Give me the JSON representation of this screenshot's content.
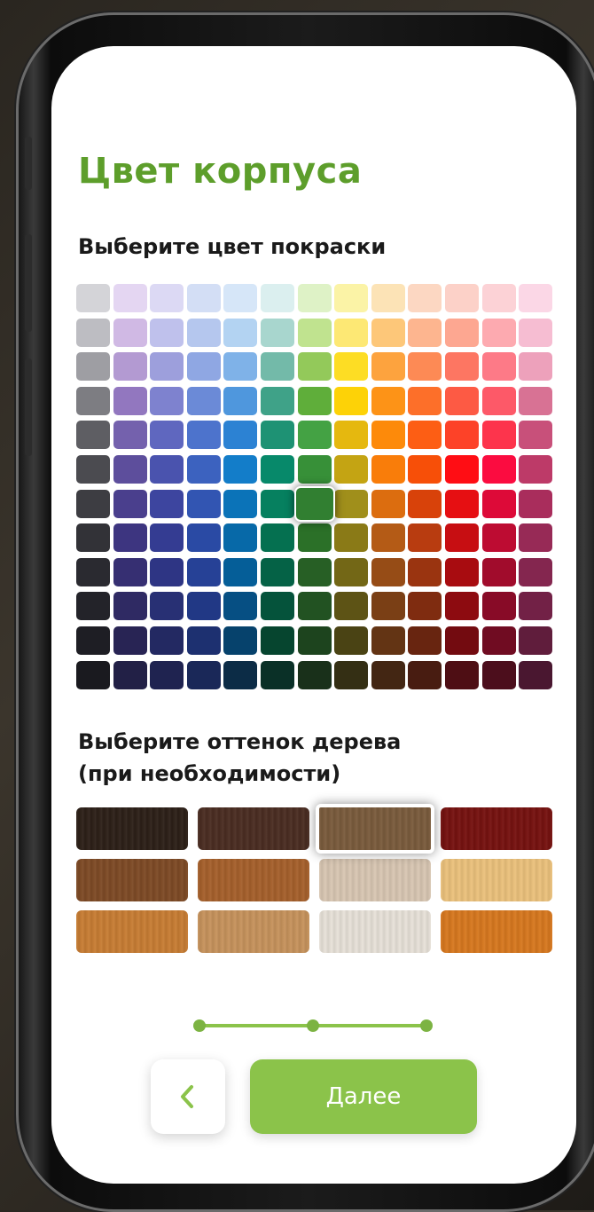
{
  "header": {
    "title": "Цвет корпуса"
  },
  "paint": {
    "subtitle": "Выберите цвет покраски",
    "selected": {
      "row": 6,
      "col": 6
    },
    "rows": [
      [
        "#d4d4d8",
        "#e4d6f2",
        "#dcd9f4",
        "#d3def5",
        "#d6e6f8",
        "#dbefef",
        "#def2c6",
        "#fbf3a6",
        "#fce3b6",
        "#fcd7c2",
        "#fcd1c8",
        "#fcd2d6",
        "#fbd7e6"
      ],
      [
        "#bdbdc2",
        "#d0b9e4",
        "#bfc1ec",
        "#b5c7ee",
        "#b3d3f2",
        "#a8d6ce",
        "#c0e38f",
        "#fde874",
        "#fdc779",
        "#fdb58f",
        "#fda791",
        "#fdaab0",
        "#f6bdd2"
      ],
      [
        "#9e9ea3",
        "#b39ad2",
        "#9d9fdc",
        "#8fa7e3",
        "#7fb2e8",
        "#73baa9",
        "#93c95a",
        "#fddd24",
        "#fda33e",
        "#fd8a55",
        "#fd7662",
        "#fd7a87",
        "#eda1bb"
      ],
      [
        "#7d7d82",
        "#9277bf",
        "#7e82cf",
        "#6b8ad7",
        "#4f97dd",
        "#3fa288",
        "#5fae3a",
        "#fdd207",
        "#fd9317",
        "#fd6f29",
        "#fd5a44",
        "#fd5968",
        "#d87294"
      ],
      [
        "#5e5e63",
        "#7461ad",
        "#5f67bf",
        "#4d73cc",
        "#2c82d3",
        "#1e9274",
        "#44a244",
        "#e5b80f",
        "#fd8a0a",
        "#fd5e14",
        "#fd4228",
        "#fd344c",
        "#c8507a"
      ],
      [
        "#4b4b50",
        "#5d4e9c",
        "#4a53ae",
        "#3c62bf",
        "#137dc9",
        "#07896a",
        "#379038",
        "#c4a413",
        "#f97d0a",
        "#f74f08",
        "#ff0d14",
        "#fb0c40",
        "#bd3a68"
      ],
      [
        "#3d3d42",
        "#4a3f8d",
        "#3d459f",
        "#3255b2",
        "#0b73b8",
        "#06805f",
        "#317f31",
        "#a08f1b",
        "#dc6d0f",
        "#d8420a",
        "#e60f12",
        "#dd0a38",
        "#a92d5c"
      ],
      [
        "#323237",
        "#3d3580",
        "#343c92",
        "#2a4aa4",
        "#0769a8",
        "#057050",
        "#2b7028",
        "#8a7a17",
        "#b45b16",
        "#b83c10",
        "#c70e12",
        "#bd0c32",
        "#972a56"
      ],
      [
        "#2a2a30",
        "#362f72",
        "#2e3584",
        "#264196",
        "#055e98",
        "#056246",
        "#275f25",
        "#736716",
        "#964c16",
        "#9a3410",
        "#a80c10",
        "#a10c2c",
        "#84264f"
      ],
      [
        "#232329",
        "#2f2a63",
        "#283074",
        "#213885",
        "#064f83",
        "#05533b",
        "#225222",
        "#5d5315",
        "#7a3f15",
        "#7f2c10",
        "#8d0b10",
        "#880b27",
        "#722146"
      ],
      [
        "#1e1e24",
        "#282454",
        "#232962",
        "#1d3070",
        "#06426c",
        "#06452f",
        "#1d441e",
        "#4a4314",
        "#633414",
        "#682510",
        "#730b10",
        "#700c22",
        "#601d3c"
      ],
      [
        "#1a1a1f",
        "#222046",
        "#1f2350",
        "#1a2858",
        "#0c2c46",
        "#0a3027",
        "#19301a",
        "#342f14",
        "#432613",
        "#481c11",
        "#4e0e14",
        "#4c0e1c",
        "#4a1730"
      ]
    ]
  },
  "wood": {
    "subtitle": "Выберите оттенок дерева (при необходимости)",
    "selected": {
      "row": 0,
      "col": 2
    },
    "rows": [
      [
        "#2c1f17",
        "#4a2c21",
        "#7a5b3c",
        "#76110f"
      ],
      [
        "#7e4a25",
        "#a6602b",
        "#d9c7b3",
        "#ecc27c"
      ],
      [
        "#c87d33",
        "#c7935c",
        "#e8e2d9",
        "#d8781e"
      ]
    ]
  },
  "progress": {
    "current_step": 3,
    "total_steps": 3
  },
  "nav": {
    "back_icon": "chevron-left-icon",
    "next_label": "Далее",
    "accent": "#8bc34a",
    "title_color": "#5d9e2b"
  }
}
